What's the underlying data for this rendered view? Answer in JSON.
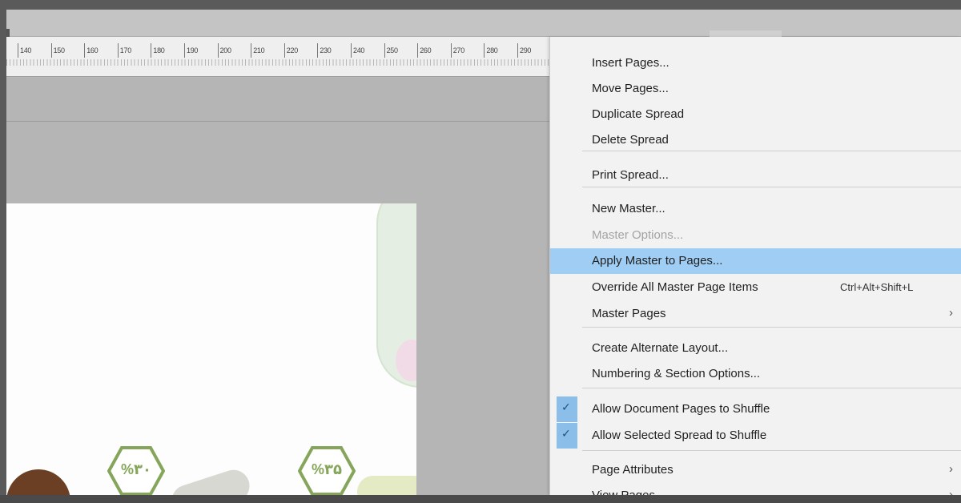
{
  "ruler": {
    "labels": [
      "140",
      "150",
      "160",
      "170",
      "180",
      "190",
      "200",
      "210",
      "220",
      "230",
      "240",
      "250",
      "260",
      "270",
      "280",
      "290"
    ]
  },
  "document": {
    "badge_1_text": "%۳۰",
    "badge_2_text": "%۳۵"
  },
  "menu": {
    "items": [
      {
        "label": "Insert Pages..."
      },
      {
        "label": "Move Pages..."
      },
      {
        "label": "Duplicate Spread"
      },
      {
        "label": "Delete Spread"
      },
      {
        "label": "Print Spread..."
      },
      {
        "label": "New Master..."
      },
      {
        "label": "Master Options...",
        "disabled": true
      },
      {
        "label": "Apply Master to Pages...",
        "highlighted": true
      },
      {
        "label": "Override All Master Page Items",
        "shortcut": "Ctrl+Alt+Shift+L"
      },
      {
        "label": "Master Pages",
        "submenu": true
      },
      {
        "label": "Create Alternate Layout..."
      },
      {
        "label": "Numbering & Section Options..."
      },
      {
        "label": "Allow Document Pages to Shuffle",
        "checked": true
      },
      {
        "label": "Allow Selected Spread to Shuffle",
        "checked": true
      },
      {
        "label": "Page Attributes",
        "submenu": true
      },
      {
        "label": "View Pages",
        "submenu": true
      }
    ],
    "arrow_glyph": "›",
    "check_glyph": "✓"
  },
  "colors": {
    "highlight": "#9fcdf3",
    "check_column": "#8bbfe9",
    "badge_green": "#85a65a"
  }
}
